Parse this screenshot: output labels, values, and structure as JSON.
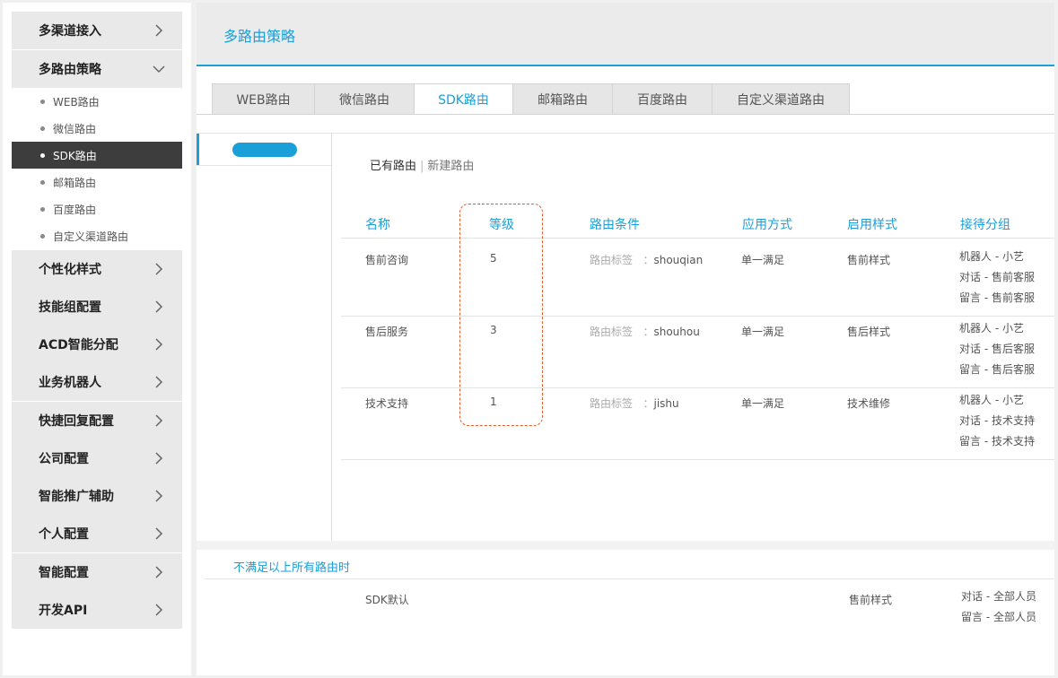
{
  "sidebar": {
    "groups_top": [
      {
        "label": "多渠道接入"
      },
      {
        "label": "多路由策略"
      }
    ],
    "sub_items": [
      {
        "label": "WEB路由"
      },
      {
        "label": "微信路由"
      },
      {
        "label": "SDK路由"
      },
      {
        "label": "邮箱路由"
      },
      {
        "label": "百度路由"
      },
      {
        "label": "自定义渠道路由"
      }
    ],
    "groups_bottom": [
      {
        "label": "个性化样式"
      },
      {
        "label": "技能组配置"
      },
      {
        "label": "ACD智能分配"
      },
      {
        "label": "业务机器人"
      },
      {
        "label": "快捷回复配置"
      },
      {
        "label": "公司配置"
      },
      {
        "label": "智能推广辅助"
      },
      {
        "label": "个人配置"
      },
      {
        "label": "智能配置"
      },
      {
        "label": "开发API"
      }
    ]
  },
  "header": {
    "title": "多路由策略"
  },
  "tabs": [
    {
      "label": "WEB路由"
    },
    {
      "label": "微信路由"
    },
    {
      "label": "SDK路由"
    },
    {
      "label": "邮箱路由"
    },
    {
      "label": "百度路由"
    },
    {
      "label": "自定义渠道路由"
    }
  ],
  "subnav": {
    "existing": "已有路由",
    "separator": "|",
    "new": "新建路由"
  },
  "table": {
    "headers": [
      "名称",
      "等级",
      "路由条件",
      "应用方式",
      "启用样式",
      "接待分组"
    ],
    "condition_label": "路由标签",
    "condition_sep": "：",
    "rows": [
      {
        "name": "售前咨询",
        "level": "5",
        "tag": "shouqian",
        "method": "单一满足",
        "style": "售前样式",
        "groups": [
          "机器人 - 小艺",
          "对话 - 售前客服",
          "留言 - 售前客服"
        ]
      },
      {
        "name": "售后服务",
        "level": "3",
        "tag": "shouhou",
        "method": "单一满足",
        "style": "售后样式",
        "groups": [
          "机器人 - 小艺",
          "对话 - 售后客服",
          "留言 - 售后客服"
        ]
      },
      {
        "name": "技术支持",
        "level": "1",
        "tag": "jishu",
        "method": "单一满足",
        "style": "技术维修",
        "groups": [
          "机器人 - 小艺",
          "对话 - 技术支持",
          "留言 - 技术支持"
        ]
      }
    ]
  },
  "footer": {
    "title": "不满足以上所有路由时",
    "name": "SDK默认",
    "style": "售前样式",
    "groups": [
      "对话 - 全部人员",
      "留言 - 全部人员"
    ]
  }
}
